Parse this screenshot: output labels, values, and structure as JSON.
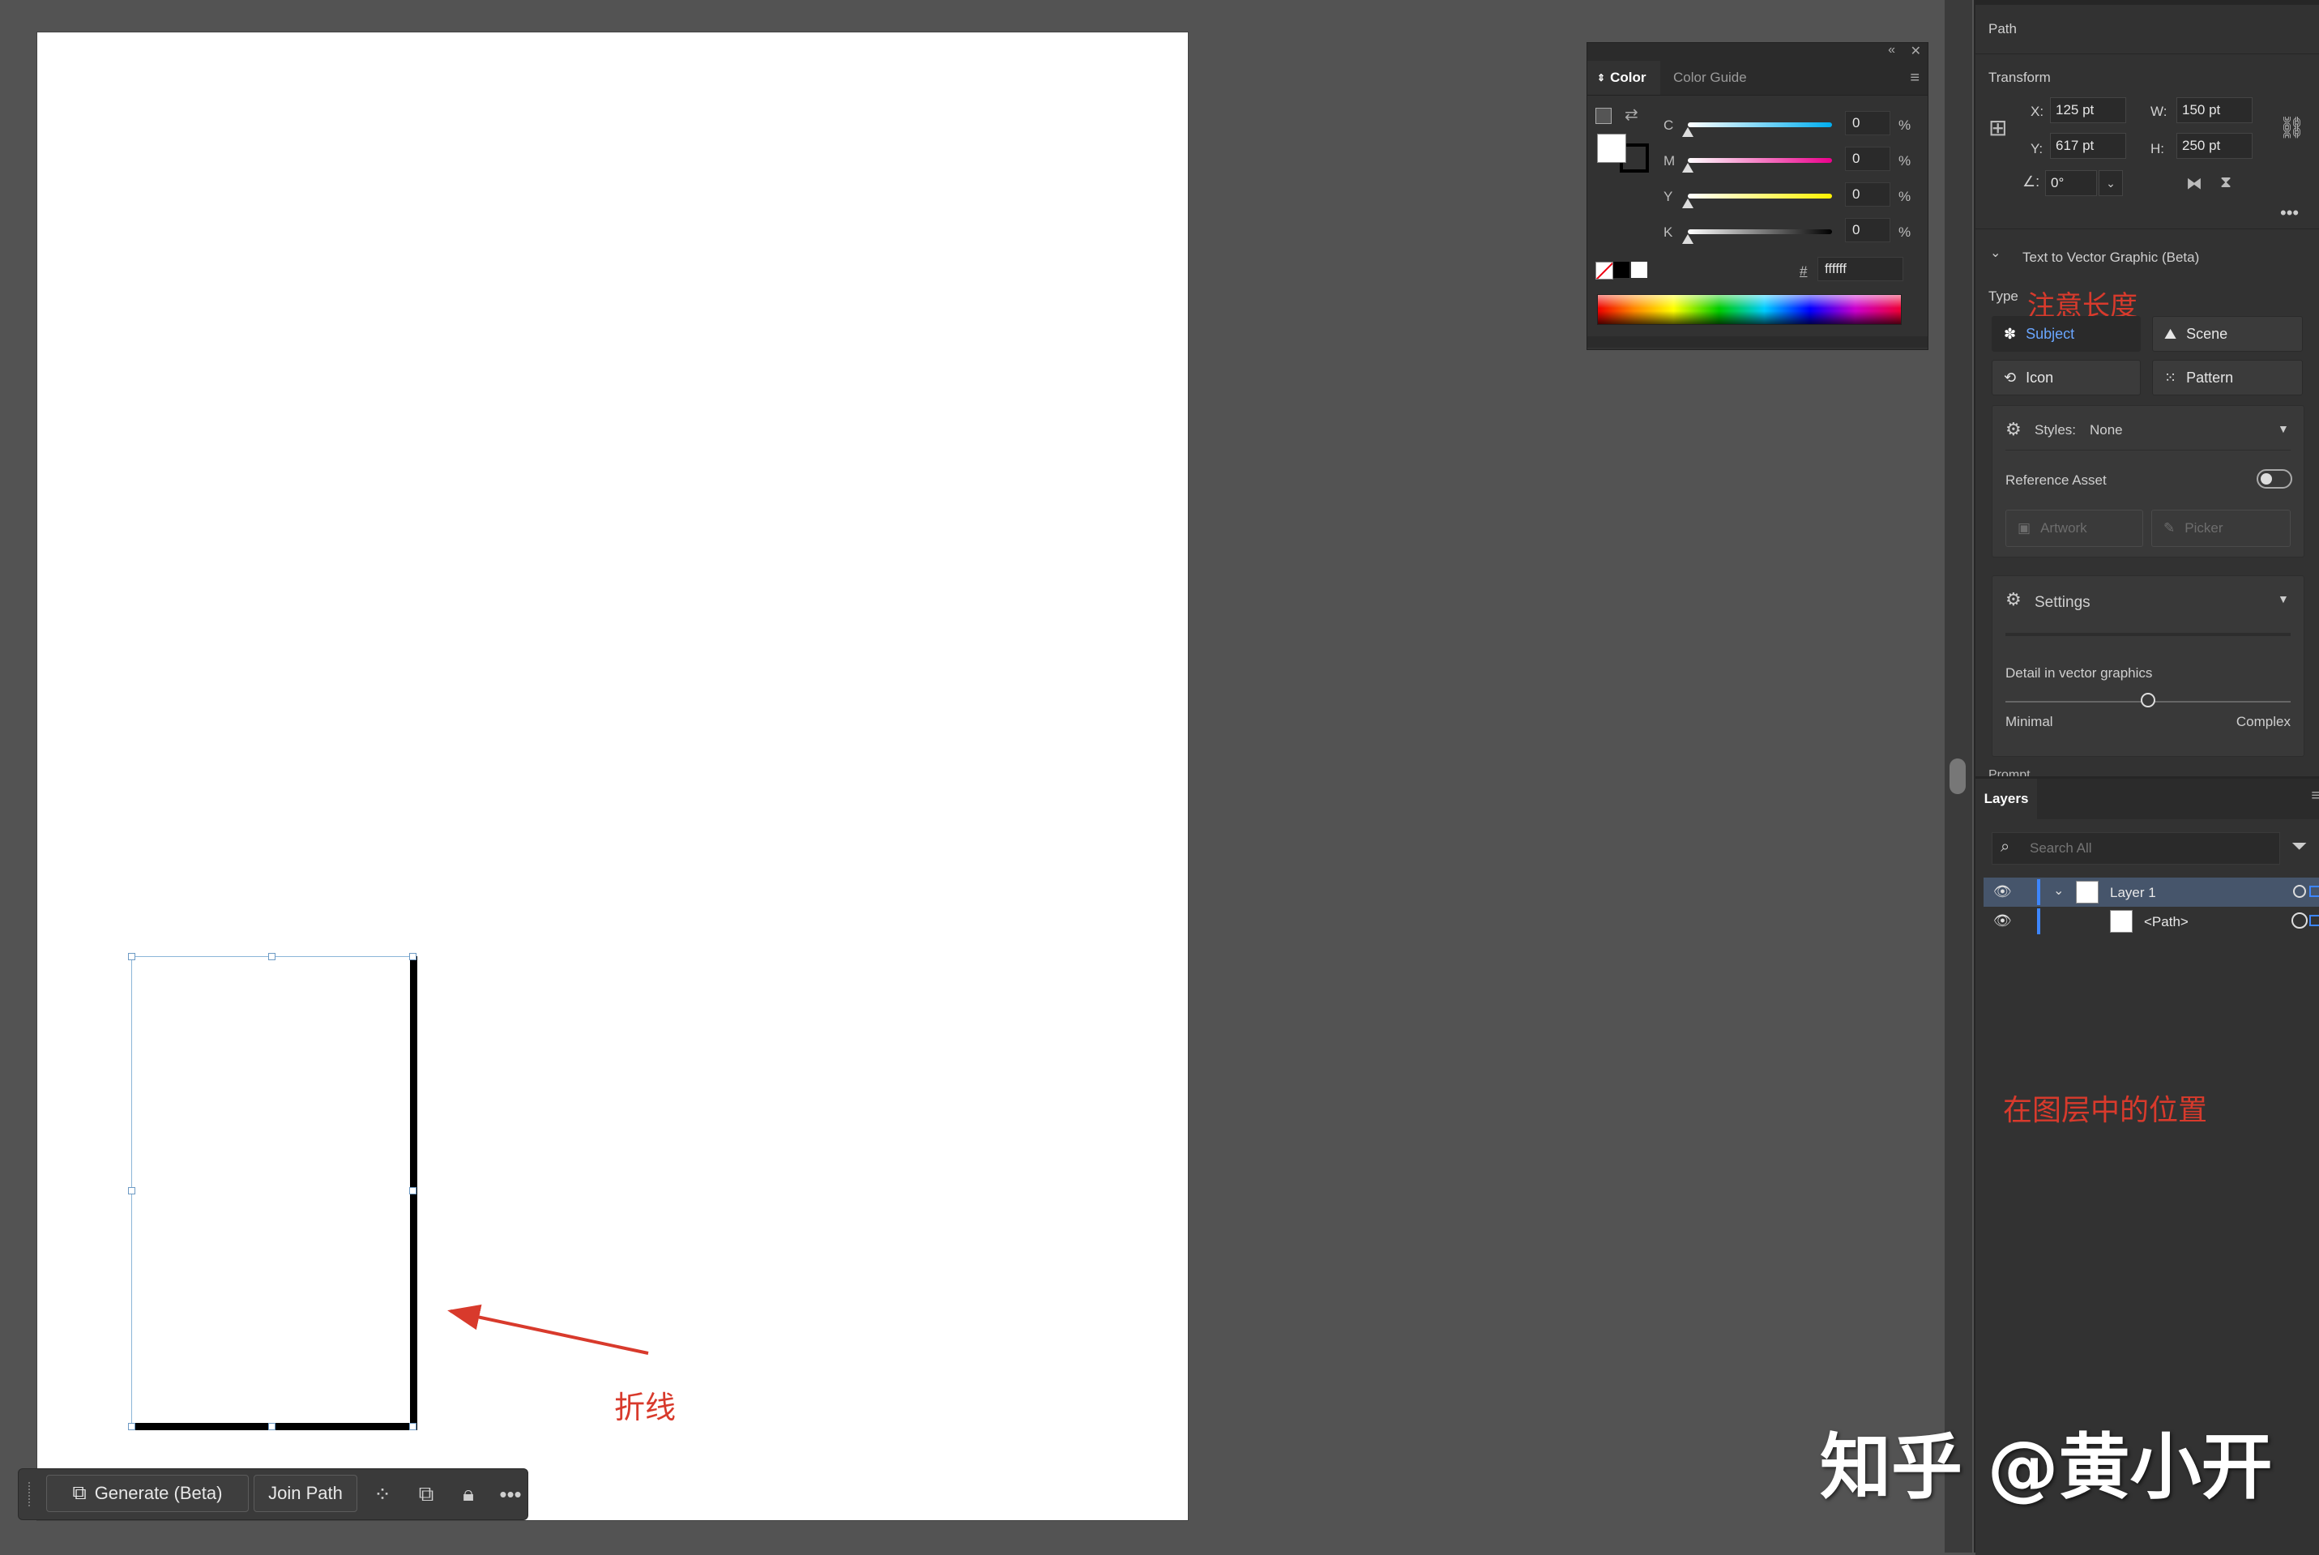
{
  "canvas": {
    "annotation_polyline": "折线"
  },
  "context_toolbar": {
    "generate_label": "Generate (Beta)",
    "join_path_label": "Join Path",
    "icons": [
      "recolor-icon",
      "arrange-icon",
      "lock-icon",
      "more-icon"
    ]
  },
  "color_panel": {
    "tabs": [
      "Color",
      "Color Guide"
    ],
    "sliders": [
      {
        "label": "C",
        "value": "0",
        "unit": "%"
      },
      {
        "label": "M",
        "value": "0",
        "unit": "%"
      },
      {
        "label": "Y",
        "value": "0",
        "unit": "%"
      },
      {
        "label": "K",
        "value": "0",
        "unit": "%"
      }
    ],
    "hex_symbol": "#",
    "hex_value": "ffffff"
  },
  "properties": {
    "section_title": "Path",
    "transform_title": "Transform",
    "x_label": "X:",
    "x_value": "125 pt",
    "y_label": "Y:",
    "y_value": "617 pt",
    "w_label": "W:",
    "w_value": "150 pt",
    "h_label": "H:",
    "h_value": "250 pt",
    "angle_value": "0°",
    "annotation_length": "注意长度",
    "t2v_title": "Text to Vector Graphic (Beta)",
    "type_label": "Type",
    "types": [
      "Subject",
      "Scene",
      "Icon",
      "Pattern"
    ],
    "styles_label": "Styles:",
    "styles_value": "None",
    "reference_asset_label": "Reference Asset",
    "artwork_label": "Artwork",
    "picker_label": "Picker",
    "settings_label": "Settings",
    "detail_label": "Detail in vector graphics",
    "detail_min": "Minimal",
    "detail_max": "Complex",
    "detail_level": 0.5,
    "cut_label": "Prompt"
  },
  "layers": {
    "tab": "Layers",
    "search_placeholder": "Search All",
    "rows": [
      {
        "name": "Layer 1"
      },
      {
        "name": "<Path>"
      }
    ],
    "annotation_position": "在图层中的位置"
  },
  "watermark": "知乎 @黄小开",
  "colors": {
    "annotation": "#d83a2c",
    "selection": "#3d86ff",
    "accent": "#6aa6ff"
  }
}
